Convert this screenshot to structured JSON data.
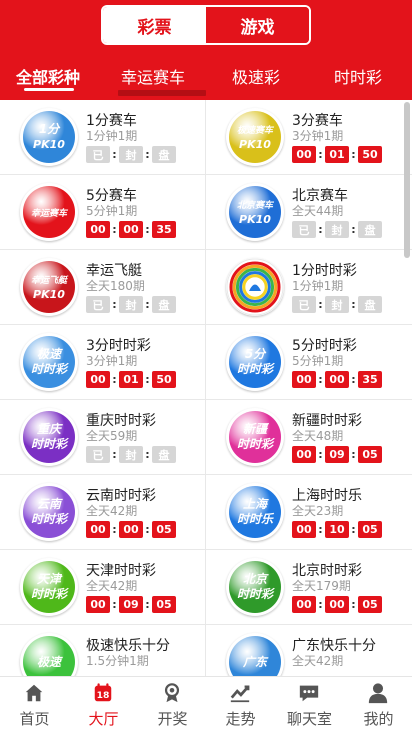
{
  "header": {
    "segments": [
      {
        "label": "彩票",
        "active": true
      },
      {
        "label": "游戏",
        "active": false
      }
    ],
    "tabs": [
      {
        "label": "全部彩种",
        "active": true
      },
      {
        "label": "幸运赛车",
        "active": false
      },
      {
        "label": "极速彩",
        "active": false
      },
      {
        "label": "时时彩",
        "active": false
      }
    ]
  },
  "lotteries": [
    {
      "name": "1分赛车",
      "freq": "1分钟1期",
      "status": "closed",
      "countdown": [
        "已",
        "封",
        "盘"
      ],
      "logo": {
        "icon": "pk10-1min-logo",
        "text1": "1分",
        "text2": "PK10",
        "bg": "#2f86d9"
      }
    },
    {
      "name": "3分赛车",
      "freq": "3分钟1期",
      "status": "live",
      "countdown": [
        "00",
        "01",
        "50"
      ],
      "logo": {
        "icon": "speed-racing-pk10-logo",
        "text1": "极速赛车",
        "text2": "PK10",
        "bg": "#d9c01a"
      }
    },
    {
      "name": "5分赛车",
      "freq": "5分钟1期",
      "status": "live",
      "countdown": [
        "00",
        "00",
        "35"
      ],
      "logo": {
        "icon": "lucky-racing-car-logo",
        "text1": "幸运赛车",
        "text2": "",
        "bg": "#e3131b"
      }
    },
    {
      "name": "北京赛车",
      "freq": "全天44期",
      "status": "closed",
      "countdown": [
        "已",
        "封",
        "盘"
      ],
      "logo": {
        "icon": "beijing-racing-pk10-logo",
        "text1": "北京赛车",
        "text2": "PK10",
        "bg": "#1f6ed6"
      }
    },
    {
      "name": "幸运飞艇",
      "freq": "全天180期",
      "status": "closed",
      "countdown": [
        "已",
        "封",
        "盘"
      ],
      "logo": {
        "icon": "lucky-airship-pk10-logo",
        "text1": "幸运飞艇",
        "text2": "PK10",
        "bg": "#c8151b"
      }
    },
    {
      "name": "1分时时彩",
      "freq": "1分钟1期",
      "status": "closed",
      "countdown": [
        "已",
        "封",
        "盘"
      ],
      "logo": {
        "icon": "ssc-rainbow-logo",
        "text1": "",
        "text2": "",
        "bg": "#ffffff"
      }
    },
    {
      "name": "3分时时彩",
      "freq": "3分钟1期",
      "status": "live",
      "countdown": [
        "00",
        "01",
        "50"
      ],
      "logo": {
        "icon": "speed-ssc-logo",
        "text1": "极速",
        "text2": "时时彩",
        "bg": "#3a8fe0"
      }
    },
    {
      "name": "5分时时彩",
      "freq": "5分钟1期",
      "status": "live",
      "countdown": [
        "00",
        "00",
        "35"
      ],
      "logo": {
        "icon": "ssc-5min-logo",
        "text1": "5分",
        "text2": "时时彩",
        "bg": "#1f78e0"
      }
    },
    {
      "name": "重庆时时彩",
      "freq": "全天59期",
      "status": "closed",
      "countdown": [
        "已",
        "封",
        "盘"
      ],
      "logo": {
        "icon": "chongqing-ssc-logo",
        "text1": "重庆",
        "text2": "时时彩",
        "bg": "#7b2fc4"
      }
    },
    {
      "name": "新疆时时彩",
      "freq": "全天48期",
      "status": "live",
      "countdown": [
        "00",
        "09",
        "05"
      ],
      "logo": {
        "icon": "xinjiang-ssc-logo",
        "text1": "新疆",
        "text2": "时时彩",
        "bg": "#e0309a"
      }
    },
    {
      "name": "云南时时彩",
      "freq": "全天42期",
      "status": "live",
      "countdown": [
        "00",
        "00",
        "05"
      ],
      "logo": {
        "icon": "yunnan-ssc-logo",
        "text1": "云南",
        "text2": "时时彩",
        "bg": "#8a4fd6"
      }
    },
    {
      "name": "上海时时乐",
      "freq": "全天23期",
      "status": "live",
      "countdown": [
        "00",
        "10",
        "05"
      ],
      "logo": {
        "icon": "shanghai-ssl-logo",
        "text1": "上海",
        "text2": "时时乐",
        "bg": "#1f78e0"
      }
    },
    {
      "name": "天津时时彩",
      "freq": "全天42期",
      "status": "live",
      "countdown": [
        "00",
        "09",
        "05"
      ],
      "logo": {
        "icon": "tianjin-ssc-logo",
        "text1": "天津",
        "text2": "时时彩",
        "bg": "#4fb81a"
      }
    },
    {
      "name": "北京时时彩",
      "freq": "全天179期",
      "status": "live",
      "countdown": [
        "00",
        "00",
        "05"
      ],
      "logo": {
        "icon": "beijing-ssc-logo",
        "text1": "北京",
        "text2": "时时彩",
        "bg": "#2f9a2a"
      }
    },
    {
      "name": "极速快乐十分",
      "freq": "1.5分钟1期",
      "status": "none",
      "countdown": [],
      "logo": {
        "icon": "speed-happy10-logo",
        "text1": "极速",
        "text2": "",
        "bg": "#3cc23c"
      }
    },
    {
      "name": "广东快乐十分",
      "freq": "全天42期",
      "status": "none",
      "countdown": [],
      "logo": {
        "icon": "guangdong-happy10-logo",
        "text1": "广东",
        "text2": "",
        "bg": "#2f86d9"
      }
    }
  ],
  "bottom_nav": [
    {
      "label": "首页",
      "icon": "home-icon",
      "active": false
    },
    {
      "label": "大厅",
      "icon": "lottery-hall-icon",
      "badge": "18",
      "active": true
    },
    {
      "label": "开奖",
      "icon": "draw-results-icon",
      "active": false
    },
    {
      "label": "走势",
      "icon": "trend-chart-icon",
      "active": false
    },
    {
      "label": "聊天室",
      "icon": "chat-icon",
      "active": false
    },
    {
      "label": "我的",
      "icon": "profile-icon",
      "active": false
    }
  ],
  "colors": {
    "brand": "#e3131b",
    "closed_box": "#d6d6d6",
    "text_muted": "#9a9a9a"
  }
}
